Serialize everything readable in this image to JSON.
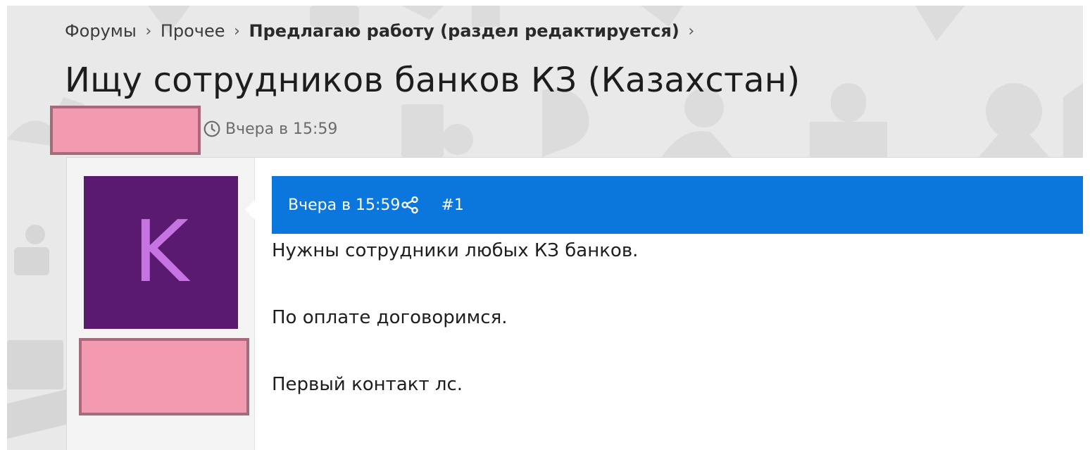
{
  "breadcrumb": [
    {
      "label": "Форумы"
    },
    {
      "label": "Прочее"
    },
    {
      "label": "Предлагаю работу (раздел редактируется)"
    }
  ],
  "breadcrumb_separator": "›",
  "thread": {
    "title": "Ищу сотрудников банков КЗ (Казахстан)",
    "time": "Вчера в 15:59"
  },
  "post": {
    "avatar_letter": "K",
    "time": "Вчера в 15:59",
    "number": "#1",
    "lines": [
      "Нужны сотрудники любых КЗ банков.",
      "По оплате договоримся.",
      "Первый контакт лс."
    ]
  },
  "icons": {
    "time": "clock-icon",
    "share": "share-icon",
    "separator": "chevron-right-icon"
  },
  "colors": {
    "header_bar": "#0b77dd",
    "avatar_bg": "#5a1a70",
    "avatar_letter": "#c774e3",
    "redaction": "#f29bb0",
    "hero_bg": "#e9e9e9"
  }
}
